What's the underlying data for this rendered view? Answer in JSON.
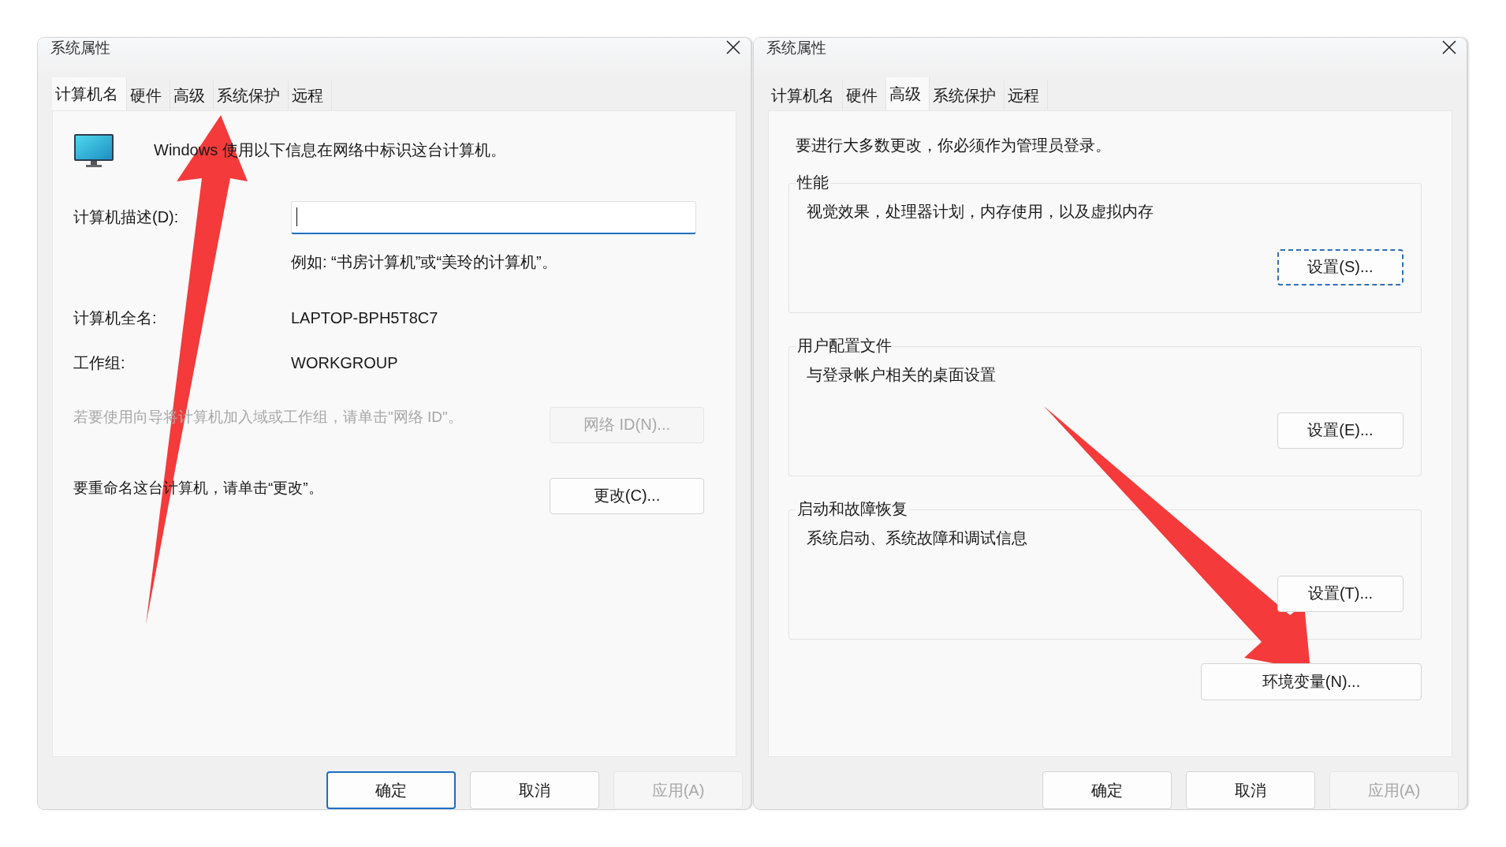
{
  "windows": [
    {
      "title": "系统属性",
      "kind": "computer_name",
      "tabs": [
        {
          "label": "计算机名",
          "selected": true
        },
        {
          "label": "硬件",
          "selected": false
        },
        {
          "label": "高级",
          "selected": false
        },
        {
          "label": "系统保护",
          "selected": false
        },
        {
          "label": "远程",
          "selected": false
        }
      ],
      "intro": "Windows 使用以下信息在网络中标识这台计算机。",
      "description_field": {
        "label": "计算机描述(D):",
        "focused": true
      },
      "hint": "例如: “书房计算机”或“美玲的计算机”。",
      "info": [
        {
          "label": "计算机全名:",
          "value": "LAPTOP-BPH5T8C7"
        },
        {
          "label": "工作组:",
          "value": "WORKGROUP"
        }
      ],
      "actions": [
        {
          "text": "若要使用向导将计算机加入域或工作组，请单击\"网络 ID\"。",
          "button": "网络 ID(N)...",
          "disabled": true
        },
        {
          "text": "要重命名这台计算机，请单击“更改”。",
          "button": "更改(C)...",
          "disabled": false
        }
      ],
      "buttons": [
        {
          "label": "确定",
          "default": true,
          "disabled": false
        },
        {
          "label": "取消",
          "default": false,
          "disabled": false
        },
        {
          "label": "应用(A)",
          "default": false,
          "disabled": true
        }
      ]
    },
    {
      "title": "系统属性",
      "kind": "advanced",
      "tabs": [
        {
          "label": "计算机名",
          "selected": false
        },
        {
          "label": "硬件",
          "selected": false
        },
        {
          "label": "高级",
          "selected": true
        },
        {
          "label": "系统保护",
          "selected": false
        },
        {
          "label": "远程",
          "selected": false
        }
      ],
      "note": "要进行大多数更改，你必须作为管理员登录。",
      "groups": [
        {
          "title": "性能",
          "text": "视觉效果，处理器计划，内存使用，以及虚拟内存",
          "button": "设置(S)...",
          "focused": true
        },
        {
          "title": "用户配置文件",
          "text": "与登录帐户相关的桌面设置",
          "button": "设置(E)...",
          "focused": false
        },
        {
          "title": "启动和故障恢复",
          "text": "系统启动、系统故障和调试信息",
          "button": "设置(T)...",
          "focused": false
        }
      ],
      "extra_button": "环境变量(N)...",
      "buttons": [
        {
          "label": "确定",
          "default": false,
          "disabled": false
        },
        {
          "label": "取消",
          "default": false,
          "disabled": false
        },
        {
          "label": "应用(A)",
          "default": false,
          "disabled": true
        }
      ]
    }
  ]
}
